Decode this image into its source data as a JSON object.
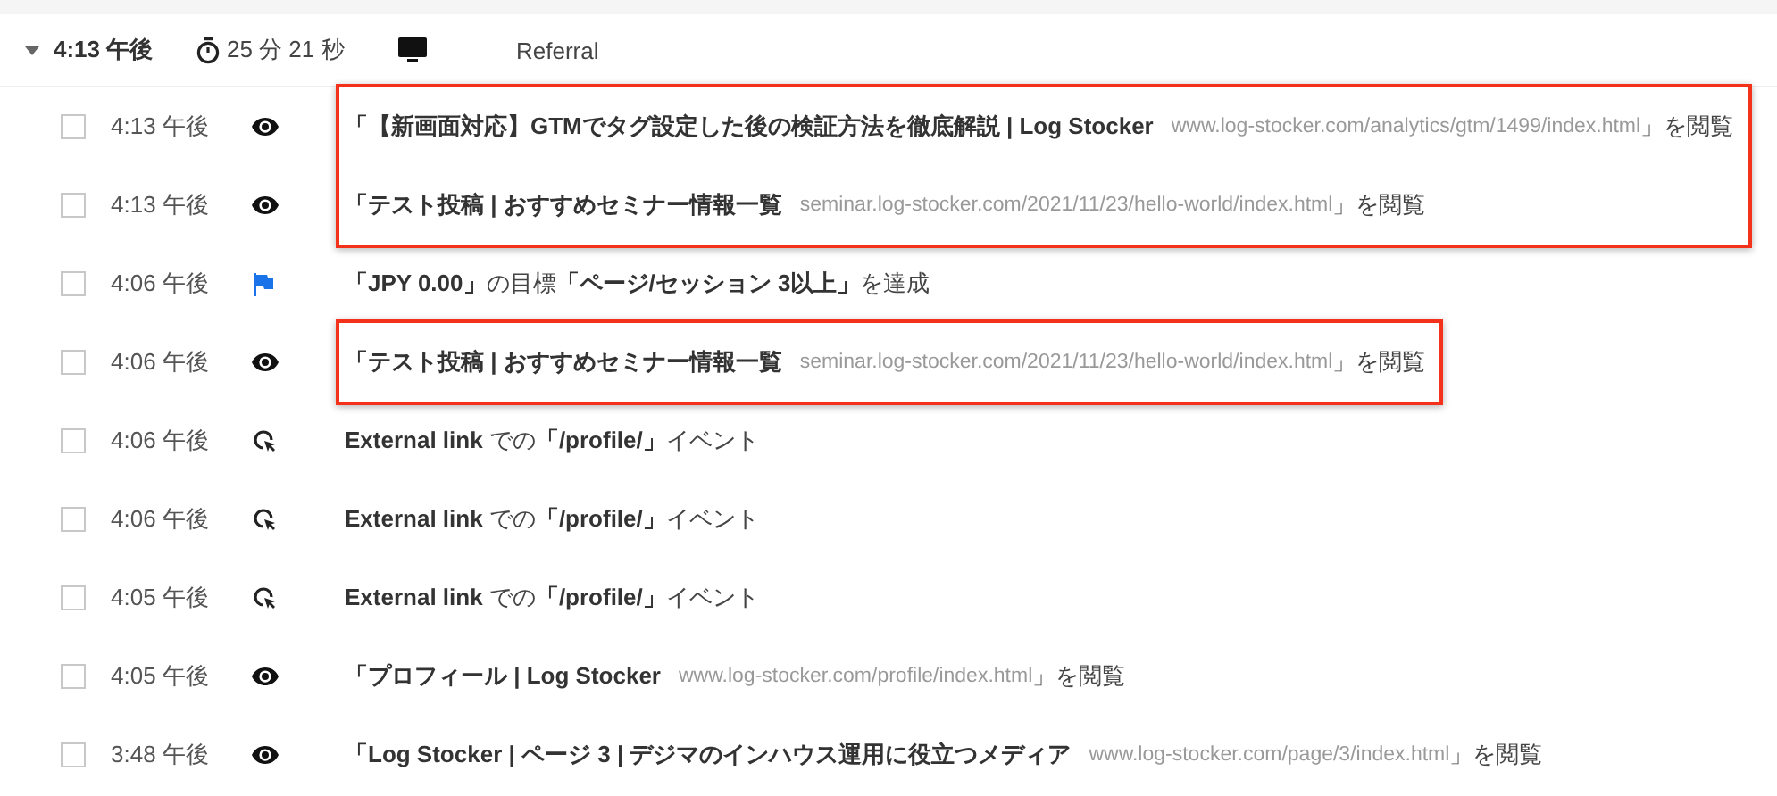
{
  "session": {
    "expanded": true,
    "time": "4:13 午後",
    "duration": "25 分 21 秒",
    "channel": "Referral"
  },
  "blocks": [
    {
      "highlighted": true,
      "rows": [
        {
          "checked": false,
          "time": "4:13 午後",
          "kind": "pageview",
          "title": "「【新画面対応】GTMでタグ設定した後の検証方法を徹底解説 | Log Stocker",
          "url": "www.log-stocker.com/analytics/gtm/1499/index.html",
          "suffix": "」を閲覧"
        },
        {
          "checked": false,
          "time": "4:13 午後",
          "kind": "pageview",
          "title": "「テスト投稿 | おすすめセミナー情報一覧",
          "url": "seminar.log-stocker.com/2021/11/23/hello-world/index.html",
          "suffix": "」を閲覧"
        }
      ]
    },
    {
      "highlighted": false,
      "rows": [
        {
          "checked": false,
          "time": "4:06 午後",
          "kind": "goal",
          "text": "**「JPY 0.00」**の目標**「ページ/セッション 3以上」**を達成"
        }
      ]
    },
    {
      "highlighted": true,
      "rows": [
        {
          "checked": false,
          "time": "4:06 午後",
          "kind": "pageview",
          "title": "「テスト投稿 | おすすめセミナー情報一覧",
          "url": "seminar.log-stocker.com/2021/11/23/hello-world/index.html",
          "suffix": "」を閲覧"
        }
      ]
    },
    {
      "highlighted": false,
      "rows": [
        {
          "checked": false,
          "time": "4:06 午後",
          "kind": "event",
          "text": "**External link** での**「/profile/」**イベント"
        },
        {
          "checked": false,
          "time": "4:06 午後",
          "kind": "event",
          "text": "**External link** での**「/profile/」**イベント"
        },
        {
          "checked": false,
          "time": "4:05 午後",
          "kind": "event",
          "text": "**External link** での**「/profile/」**イベント"
        },
        {
          "checked": false,
          "time": "4:05 午後",
          "kind": "pageview",
          "title": "「プロフィール | Log Stocker",
          "url": "www.log-stocker.com/profile/index.html",
          "suffix": "」を閲覧"
        },
        {
          "checked": false,
          "time": "3:48 午後",
          "kind": "pageview",
          "title": "「Log Stocker | ページ 3 | デジマのインハウス運用に役立つメディア",
          "url": "www.log-stocker.com/page/3/index.html",
          "suffix": "」を閲覧"
        }
      ]
    }
  ]
}
